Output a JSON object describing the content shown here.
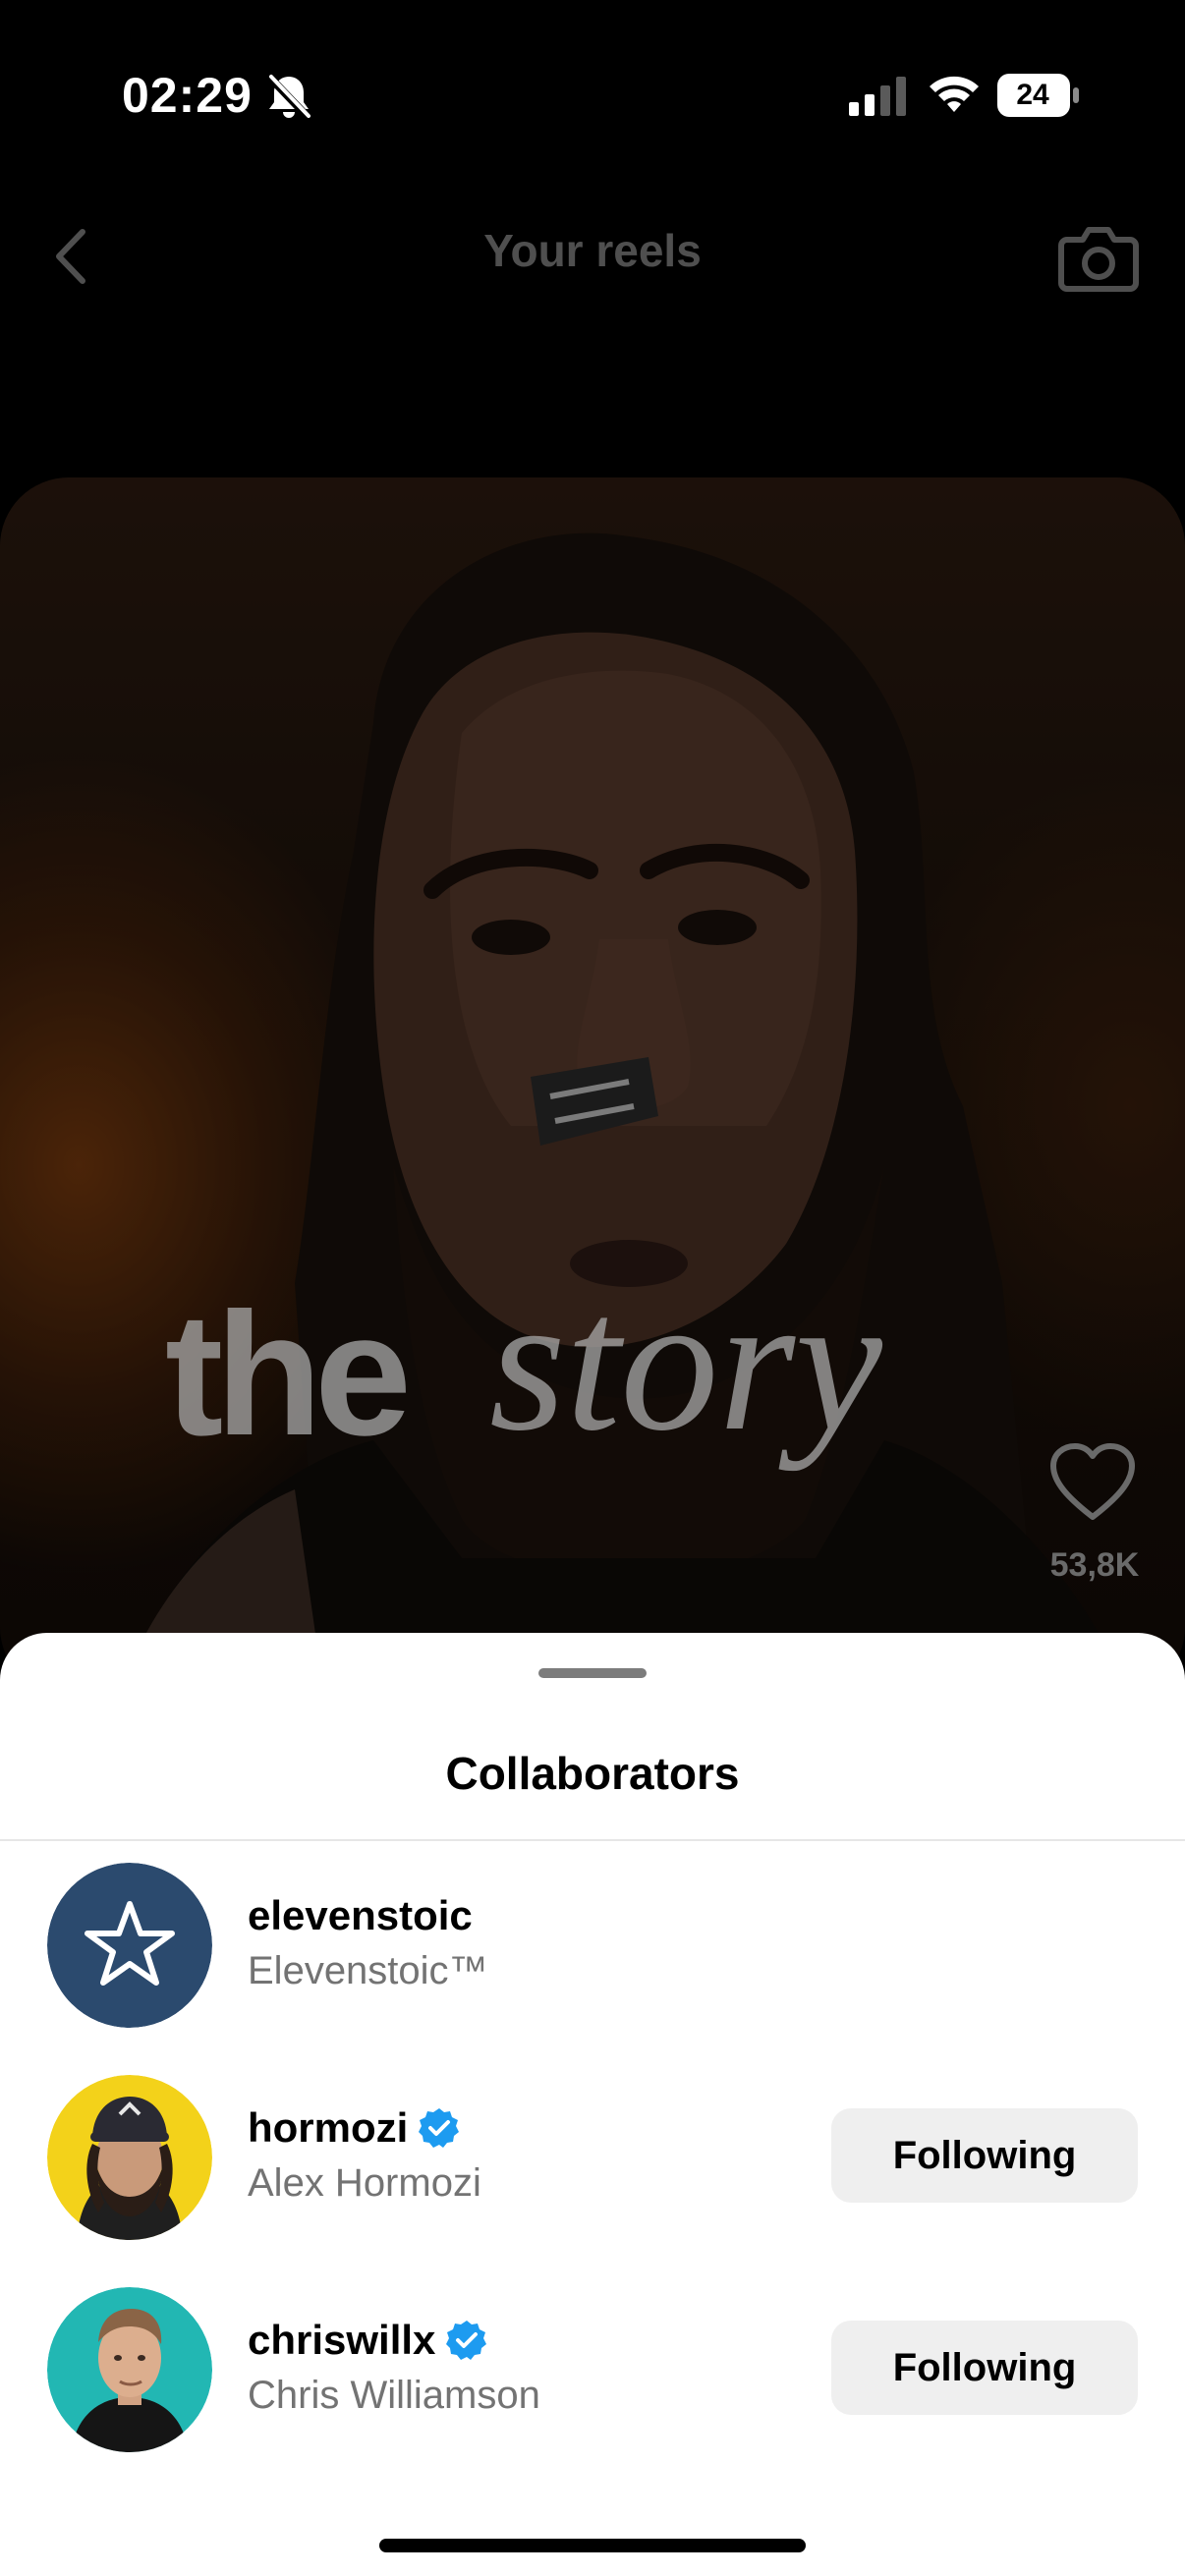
{
  "status_bar": {
    "time": "02:29",
    "battery_level": "24",
    "icons": [
      "bell-slash-icon",
      "cellular-signal-icon",
      "wifi-icon",
      "battery-icon"
    ]
  },
  "header": {
    "title": "Your reels",
    "back_icon": "chevron-left-icon",
    "camera_icon": "camera-icon"
  },
  "reel": {
    "caption_word_1": "the",
    "caption_word_2": "story",
    "like_count": "53,8K",
    "like_icon": "heart-outline-icon"
  },
  "sheet": {
    "title": "Collaborators",
    "collaborators": [
      {
        "username": "elevenstoic",
        "full_name": "Elevenstoic™",
        "verified": false,
        "button_label": "",
        "avatar_icon": "star-outline-icon",
        "avatar_color": "#2b4a6e"
      },
      {
        "username": "hormozi",
        "full_name": "Alex Hormozi",
        "verified": true,
        "button_label": "Following",
        "avatar_color": "#f3d21a"
      },
      {
        "username": "chriswillx",
        "full_name": "Chris Williamson",
        "verified": true,
        "button_label": "Following",
        "avatar_color": "#22b7b3"
      }
    ]
  },
  "colors": {
    "verified_badge": "#1d9bf0",
    "button_bg": "#efefef",
    "secondary_text": "#737373"
  }
}
